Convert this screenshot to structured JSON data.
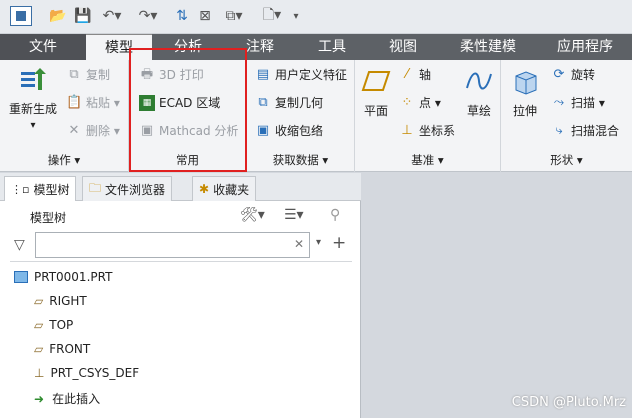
{
  "ribbon_tabs": [
    "文件",
    "模型",
    "分析",
    "注释",
    "工具",
    "视图",
    "柔性建模",
    "应用程序"
  ],
  "groups": {
    "ops": {
      "label": "操作 ▾",
      "regen": "重新生成",
      "copy": "复制",
      "paste": "粘贴",
      "del": "删除"
    },
    "common": {
      "label": "常用",
      "print3d": "3D 打印",
      "ecad": "ECAD 区域",
      "mathcad": "Mathcad 分析"
    },
    "getdata": {
      "label": "获取数据 ▾",
      "udf": "用户定义特征",
      "copygeom": "复制几何",
      "shrink": "收缩包络"
    },
    "datum": {
      "label": "基准 ▾",
      "plane": "平面",
      "axis": "轴",
      "point": "点",
      "csys": "坐标系",
      "sketch": "草绘"
    },
    "shapes": {
      "label": "形状 ▾",
      "extrude": "拉伸",
      "revolve": "旋转",
      "sweep": "扫描",
      "blend": "扫描混合"
    }
  },
  "panel": {
    "tabs": [
      "模型树",
      "文件浏览器",
      "收藏夹"
    ],
    "title": "模型树",
    "search_placeholder": "",
    "tree": [
      "PRT0001.PRT",
      "RIGHT",
      "TOP",
      "FRONT",
      "PRT_CSYS_DEF",
      "在此插入"
    ]
  },
  "watermark": "CSDN @Pluto.Mrz"
}
